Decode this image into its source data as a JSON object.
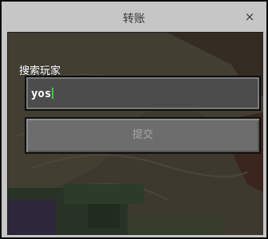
{
  "window": {
    "title": "转账",
    "close_label": "×"
  },
  "search": {
    "label": "搜索玩家",
    "value": "yos"
  },
  "submit": {
    "label": "提交"
  },
  "colors": {
    "frame": "#c6c6c6",
    "input_bg": "#4c4c4c",
    "button_bg": "#6d6d6d",
    "caret": "#3ccf3c"
  }
}
